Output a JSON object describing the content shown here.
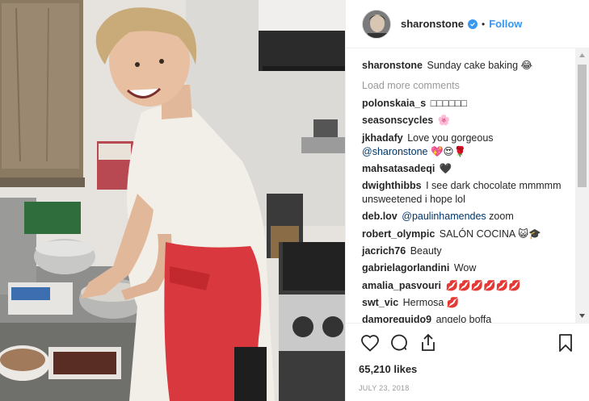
{
  "header": {
    "username": "sharonstone",
    "separator": "•",
    "follow_label": "Follow"
  },
  "caption": {
    "username": "sharonstone",
    "text": "Sunday cake baking 😂"
  },
  "load_more_label": "Load more comments",
  "comments": [
    {
      "user": "polonskaia_s",
      "text": "□□□□□□"
    },
    {
      "user": "seasonscycles",
      "text": "🌸"
    },
    {
      "user": "jkhadafy",
      "text": "Love you gorgeous",
      "mention": "@sharonstone",
      "after": "💖😍🌹"
    },
    {
      "user": "mahsatasadeqi",
      "text": "🖤"
    },
    {
      "user": "dwighthibbs",
      "text": "I see dark chocolate mmmmm unsweetened i hope lol"
    },
    {
      "user": "deb.lov",
      "text": "",
      "mention": "@paulinhamendes",
      "after": "zoom"
    },
    {
      "user": "robert_olympic",
      "text": "SALÓN COCINA 😺🎓"
    },
    {
      "user": "jacrich76",
      "text": "Beauty"
    },
    {
      "user": "gabrielagorlandini",
      "text": "Wow"
    },
    {
      "user": "amalia_pasvouri",
      "text": "💋💋💋💋💋💋"
    },
    {
      "user": "swt_vic",
      "text": "Hermosa 💋"
    },
    {
      "user": "damorequido9",
      "text": "angelo boffa"
    }
  ],
  "likes_text": "65,210 likes",
  "date_text": "JULY 23, 2018",
  "colors": {
    "accent": "#3897f0",
    "muted": "#999999",
    "text": "#262626",
    "apron": "#d9383e"
  },
  "icons": [
    "heart-icon",
    "comment-icon",
    "share-icon",
    "bookmark-icon",
    "verified-badge-icon"
  ]
}
